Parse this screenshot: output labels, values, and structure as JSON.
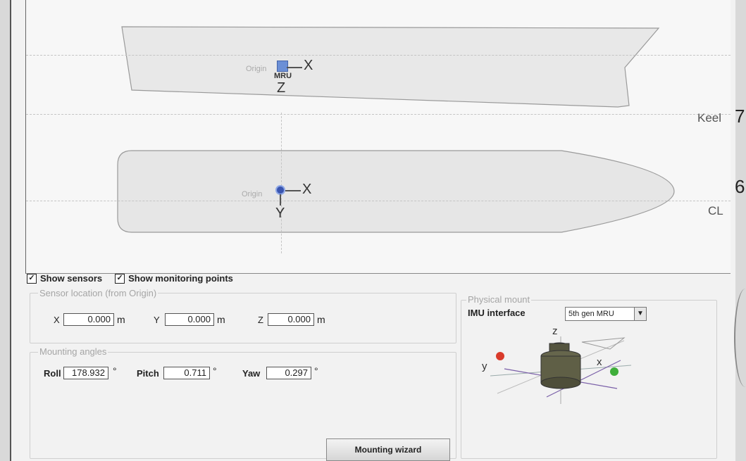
{
  "side_view": {
    "origin_label": "Origin",
    "sensor_label": "MRU",
    "axis_x": "X",
    "axis_z": "Z",
    "reference_label": "Keel"
  },
  "top_view": {
    "origin_label": "Origin",
    "axis_x": "X",
    "axis_y": "Y",
    "reference_label": "CL"
  },
  "edge_glyphs": {
    "upper": "7",
    "lower": "6"
  },
  "options": {
    "show_sensors": {
      "label": "Show sensors",
      "checked": true
    },
    "show_monitoring_points": {
      "label": "Show monitoring points",
      "checked": true
    }
  },
  "sensor_location": {
    "title": "Sensor location (from Origin)",
    "x": {
      "label": "X",
      "value": "0.000",
      "unit": "m"
    },
    "y": {
      "label": "Y",
      "value": "0.000",
      "unit": "m"
    },
    "z": {
      "label": "Z",
      "value": "0.000",
      "unit": "m"
    }
  },
  "mounting_angles": {
    "title": "Mounting angles",
    "roll": {
      "label": "Roll",
      "value": "178.932",
      "unit": "°"
    },
    "pitch": {
      "label": "Pitch",
      "value": "0.711",
      "unit": "°"
    },
    "yaw": {
      "label": "Yaw",
      "value": "0.297",
      "unit": "°"
    }
  },
  "physical_mount": {
    "title": "Physical mount",
    "imu_label": "IMU interface",
    "imu_value": "5th gen MRU",
    "axes": {
      "z": "z",
      "x": "x",
      "y": "y"
    }
  },
  "buttons": {
    "mounting_wizard": "Mounting wizard"
  },
  "colors": {
    "sensor": "#6b8fd6",
    "red_marker": "#d93b2b",
    "green_marker": "#3fae3a"
  }
}
